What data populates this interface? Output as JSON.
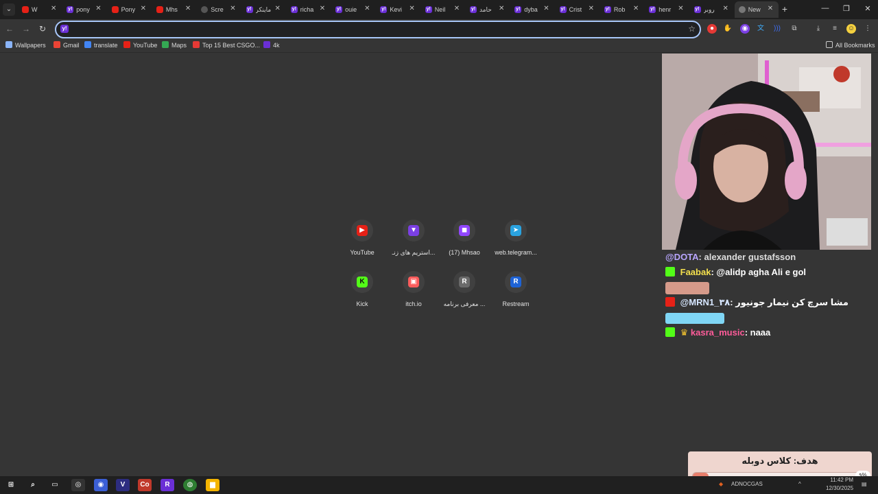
{
  "tabs": [
    {
      "label": "W",
      "fav": "yt",
      "glyph": ""
    },
    {
      "label": "pony",
      "fav": "yh",
      "glyph": "y!"
    },
    {
      "label": "Pony",
      "fav": "yt",
      "glyph": ""
    },
    {
      "label": "Mhs",
      "fav": "yt",
      "glyph": ""
    },
    {
      "label": "Scre",
      "fav": "gl",
      "glyph": ""
    },
    {
      "label": "ماینکر",
      "fav": "yh",
      "glyph": "y!"
    },
    {
      "label": "richa",
      "fav": "yh",
      "glyph": "y!"
    },
    {
      "label": "ouie",
      "fav": "yh",
      "glyph": "y!"
    },
    {
      "label": "Kevi",
      "fav": "yh",
      "glyph": "y!"
    },
    {
      "label": "Neil",
      "fav": "yh",
      "glyph": "y!"
    },
    {
      "label": "حامد",
      "fav": "yh",
      "glyph": "y!"
    },
    {
      "label": "dyba",
      "fav": "yh",
      "glyph": "y!"
    },
    {
      "label": "Crist",
      "fav": "yh",
      "glyph": "y!"
    },
    {
      "label": "Rob",
      "fav": "yh",
      "glyph": "y!"
    },
    {
      "label": "henr",
      "fav": "yh",
      "glyph": "y!"
    },
    {
      "label": "روبر",
      "fav": "yh",
      "glyph": "y!"
    },
    {
      "label": "New",
      "fav": "ch",
      "glyph": "",
      "active": true
    }
  ],
  "toolbar": {
    "omnibox_value": "",
    "omnibox_placeholder": ""
  },
  "bookmarks": [
    {
      "label": "Wallpapers",
      "color": "#8ab4f8"
    },
    {
      "label": "Gmail",
      "color": "#ea4335"
    },
    {
      "label": "translate",
      "color": "#4285f4"
    },
    {
      "label": "YouTube",
      "color": "#e62117"
    },
    {
      "label": "Maps",
      "color": "#34a853"
    },
    {
      "label": "Top 15 Best CSGO...",
      "color": "#e53935"
    },
    {
      "label": "4k",
      "color": "#6a2fd6"
    }
  ],
  "all_bookmarks": "All Bookmarks",
  "shortcuts": [
    {
      "label": "YouTube",
      "color": "#e62117",
      "glyph": "▶"
    },
    {
      "label": "استریم های زنـ...",
      "color": "#7b3fe4",
      "glyph": "▼"
    },
    {
      "label": "(17) Mhsao",
      "color": "#9146ff",
      "glyph": "◼"
    },
    {
      "label": "web.telegram...",
      "color": "#2aa3e0",
      "glyph": "➤"
    },
    {
      "label": "Kick",
      "color": "#53fc18",
      "glyph": "K"
    },
    {
      "label": "itch.io",
      "color": "#fa5c5c",
      "glyph": "▣"
    },
    {
      "label": "معرفی برنامه ...",
      "color": "#6a6a6a",
      "glyph": "R"
    },
    {
      "label": "Restream",
      "color": "#1e63d6",
      "glyph": "R"
    }
  ],
  "chat": [
    {
      "user": "@DOTA",
      "text": "alexander gustafsson"
    },
    {
      "user": "Faabak",
      "text": "@alidp agha Ali e gol"
    },
    {
      "user": "",
      "text": ""
    },
    {
      "user": "@MRN1_۳۸",
      "text": "مشا سرچ کن نیمار جونیور"
    },
    {
      "user": "",
      "text": ""
    },
    {
      "user": "kasra_music",
      "text": "naaa"
    }
  ],
  "goal": {
    "title": "هدف: کلاس دوبله",
    "percent_label": "۹%",
    "progress": 0.09
  },
  "taskbar": {
    "tray_text": "ADNOCGAS",
    "time": "11:42 PM",
    "date": "12/30/2025"
  },
  "colors": {
    "accent": "#a8c7fa",
    "page_bg": "#353535",
    "tabstrip_bg": "#1f1f1f"
  }
}
